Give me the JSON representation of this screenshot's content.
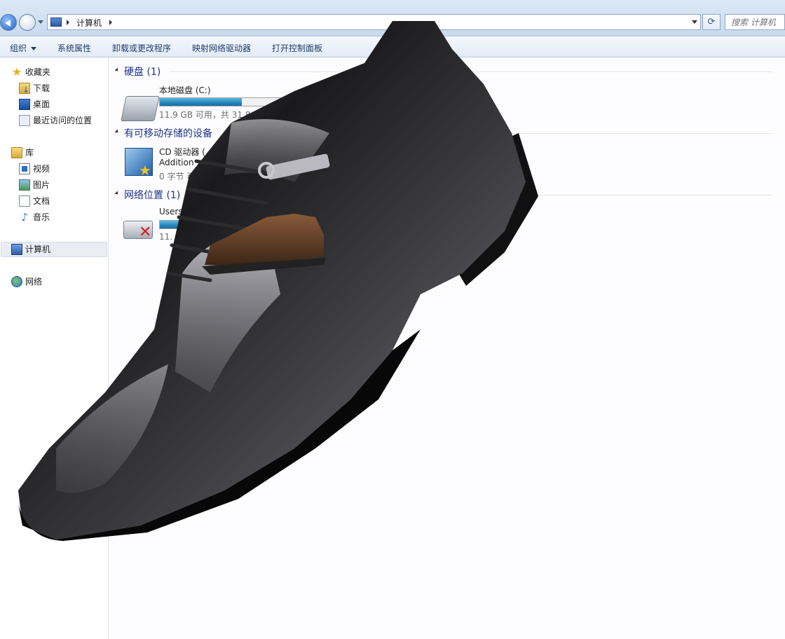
{
  "address": {
    "breadcrumb": "计算机",
    "search_placeholder": "搜索 计算机"
  },
  "toolbar": {
    "organize": "组织",
    "system_properties": "系统属性",
    "uninstall": "卸载或更改程序",
    "map_drive": "映射网络驱动器",
    "control_panel": "打开控制面板"
  },
  "nav": {
    "favorites": "收藏夹",
    "downloads": "下载",
    "desktop": "桌面",
    "recent": "最近访问的位置",
    "libraries": "库",
    "videos": "视频",
    "pictures": "图片",
    "documents": "文档",
    "music": "音乐",
    "computer": "计算机",
    "network": "网络"
  },
  "groups": {
    "hard_disks": "硬盘 (1)",
    "removable": "有可移动存储的设备",
    "network": "网络位置 (1)"
  },
  "drives": {
    "c_name": "本地磁盘 (C:)",
    "c_space": "11.9 GB 可用，共 31.8 GB",
    "c_used_fraction": 0.63,
    "cd_name": "CD 驱动器 (",
    "cd_label": "Addition",
    "cd_space": "0 字节 可",
    "net_name": "Users",
    "net_space": "11.",
    "net_used_fraction": 0.63
  },
  "colors": {
    "group_title": "#1e3287",
    "bar_fill": "#2686bd"
  }
}
